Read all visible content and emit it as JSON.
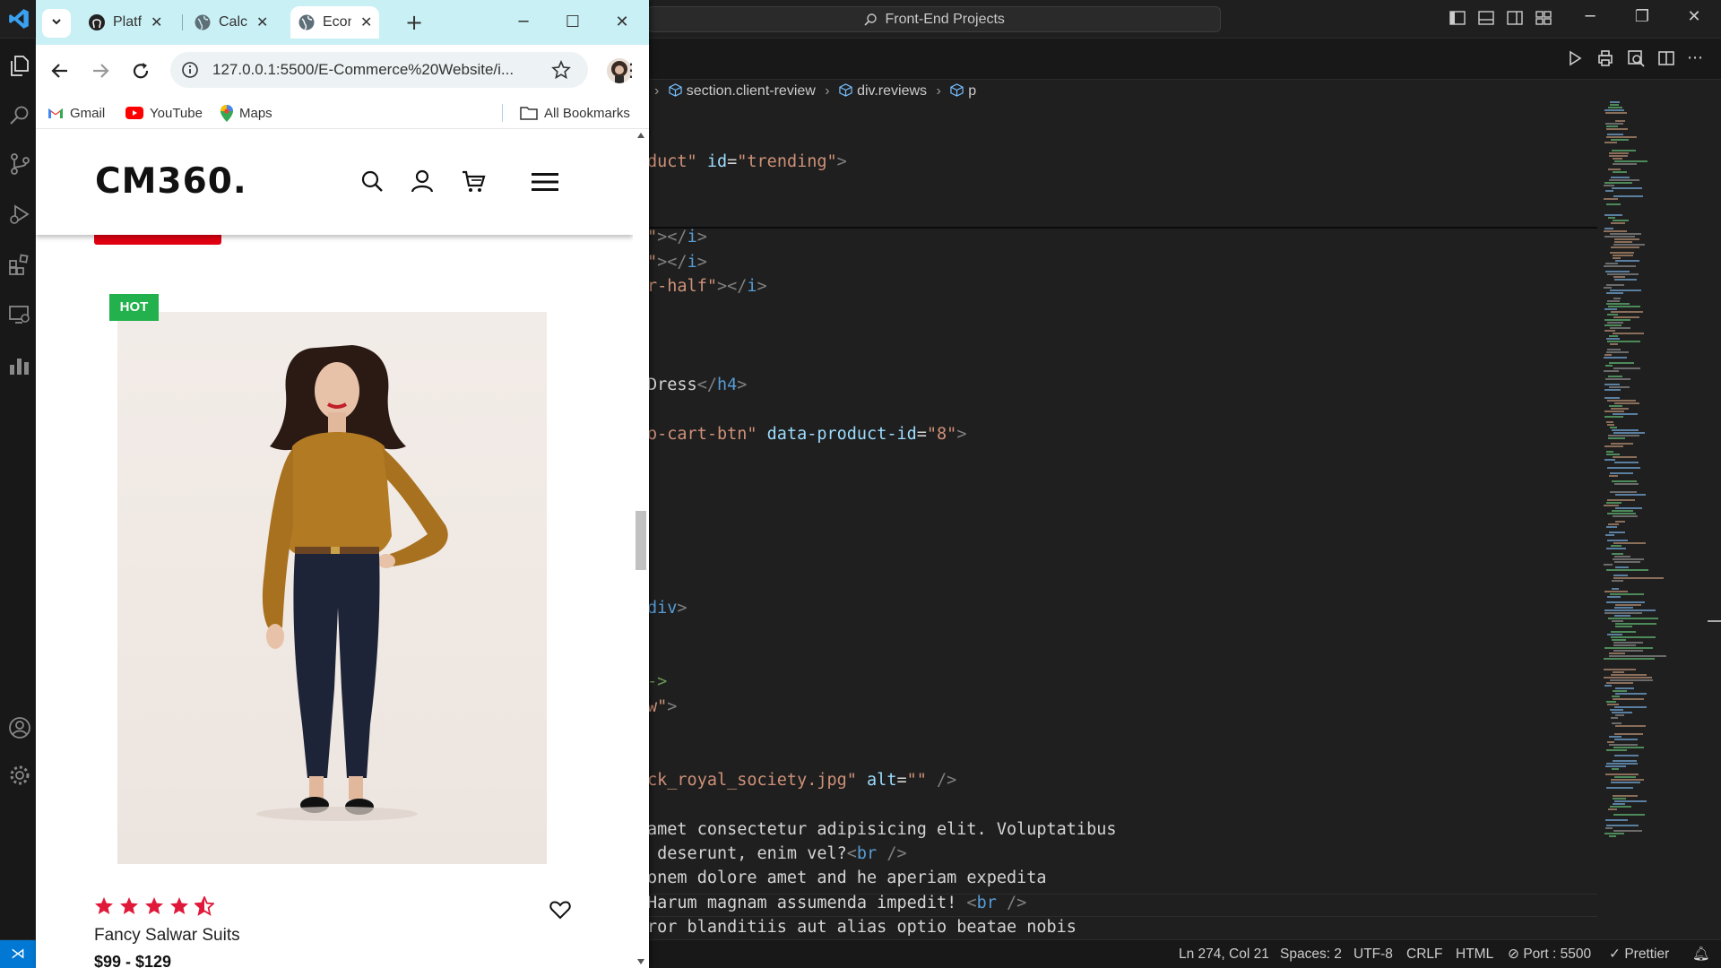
{
  "vscode": {
    "search_text": "Front-End Projects",
    "breadcrumb": [
      "section.client-review",
      "div.reviews",
      "p"
    ],
    "code_lines": [
      [
        [
          "tk-str",
          "duct\""
        ],
        [
          "tk-text",
          " "
        ],
        [
          "tk-attr",
          "id"
        ],
        [
          "tk-text",
          "="
        ],
        [
          "tk-str",
          "\"trending\""
        ],
        [
          "tk-punc",
          ">"
        ]
      ],
      [
        [
          "tk-str",
          "\""
        ],
        [
          "tk-punc",
          "></"
        ],
        [
          "tk-tag",
          "i"
        ],
        [
          "tk-punc",
          ">"
        ]
      ],
      [
        [
          "tk-str",
          "\""
        ],
        [
          "tk-punc",
          "></"
        ],
        [
          "tk-tag",
          "i"
        ],
        [
          "tk-punc",
          ">"
        ]
      ],
      [
        [
          "tk-str",
          "r-half\""
        ],
        [
          "tk-punc",
          "></"
        ],
        [
          "tk-tag",
          "i"
        ],
        [
          "tk-punc",
          ">"
        ]
      ],
      [
        [
          "tk-text",
          "Dress"
        ],
        [
          "tk-punc",
          "</"
        ],
        [
          "tk-tag",
          "h4"
        ],
        [
          "tk-punc",
          ">"
        ]
      ],
      [
        [
          "tk-str",
          "o-cart-btn\""
        ],
        [
          "tk-text",
          " "
        ],
        [
          "tk-attr",
          "data-product-id"
        ],
        [
          "tk-text",
          "="
        ],
        [
          "tk-str",
          "\"8\""
        ],
        [
          "tk-punc",
          ">"
        ]
      ],
      [
        [
          "tk-tag",
          "div"
        ],
        [
          "tk-punc",
          ">"
        ]
      ],
      [
        [
          "tk-com",
          "->"
        ]
      ],
      [
        [
          "tk-str",
          "w\""
        ],
        [
          "tk-punc",
          ">"
        ]
      ],
      [
        [
          "tk-str",
          "ck_royal_society.jpg\""
        ],
        [
          "tk-text",
          " "
        ],
        [
          "tk-attr",
          "alt"
        ],
        [
          "tk-text",
          "="
        ],
        [
          "tk-str",
          "\"\""
        ],
        [
          "tk-text",
          " "
        ],
        [
          "tk-punc",
          "/>"
        ]
      ],
      [
        [
          "tk-text",
          "amet consectetur adipisicing elit. Voluptatibus"
        ]
      ],
      [
        [
          "tk-text",
          " deserunt, enim vel?"
        ],
        [
          "tk-punc",
          "<"
        ],
        [
          "tk-tag",
          "br"
        ],
        [
          "tk-text",
          " "
        ],
        [
          "tk-punc",
          "/>"
        ]
      ],
      [
        [
          "tk-text",
          "onem dolore amet and he aperiam expedita"
        ]
      ],
      [
        [
          "tk-text",
          "Harum magnam assumenda impedit! "
        ],
        [
          "tk-punc",
          "<"
        ],
        [
          "tk-tag",
          "br"
        ],
        [
          "tk-text",
          " "
        ],
        [
          "tk-punc",
          "/>"
        ]
      ],
      [
        [
          "tk-text",
          "ror blanditiis aut alias optio beatae nobis"
        ]
      ]
    ],
    "status": {
      "position": "Ln 274, Col 21",
      "spaces": "Spaces: 2",
      "encoding": "UTF-8",
      "eol": "CRLF",
      "language": "HTML",
      "port": "Port : 5500",
      "formatter": "Prettier"
    }
  },
  "chrome": {
    "tabs": [
      {
        "title": "Platf",
        "icon": "github-icon"
      },
      {
        "title": "Calc",
        "icon": "globe-icon"
      },
      {
        "title": "Econ",
        "icon": "globe-icon"
      }
    ],
    "new_tab": "+",
    "url": "127.0.0.1:5500/E-Commerce%20Website/i...",
    "bookmarks": [
      "Gmail",
      "YouTube",
      "Maps"
    ],
    "all_bookmarks": "All Bookmarks"
  },
  "site": {
    "logo": "CM360.",
    "badge": "HOT",
    "rating": 4.5,
    "product_name": "Fancy Salwar Suits",
    "price": "$99 - $129",
    "colors": {
      "accent_red": "#e00012",
      "badge_green": "#22b14c",
      "star_red": "#e0193a"
    }
  }
}
